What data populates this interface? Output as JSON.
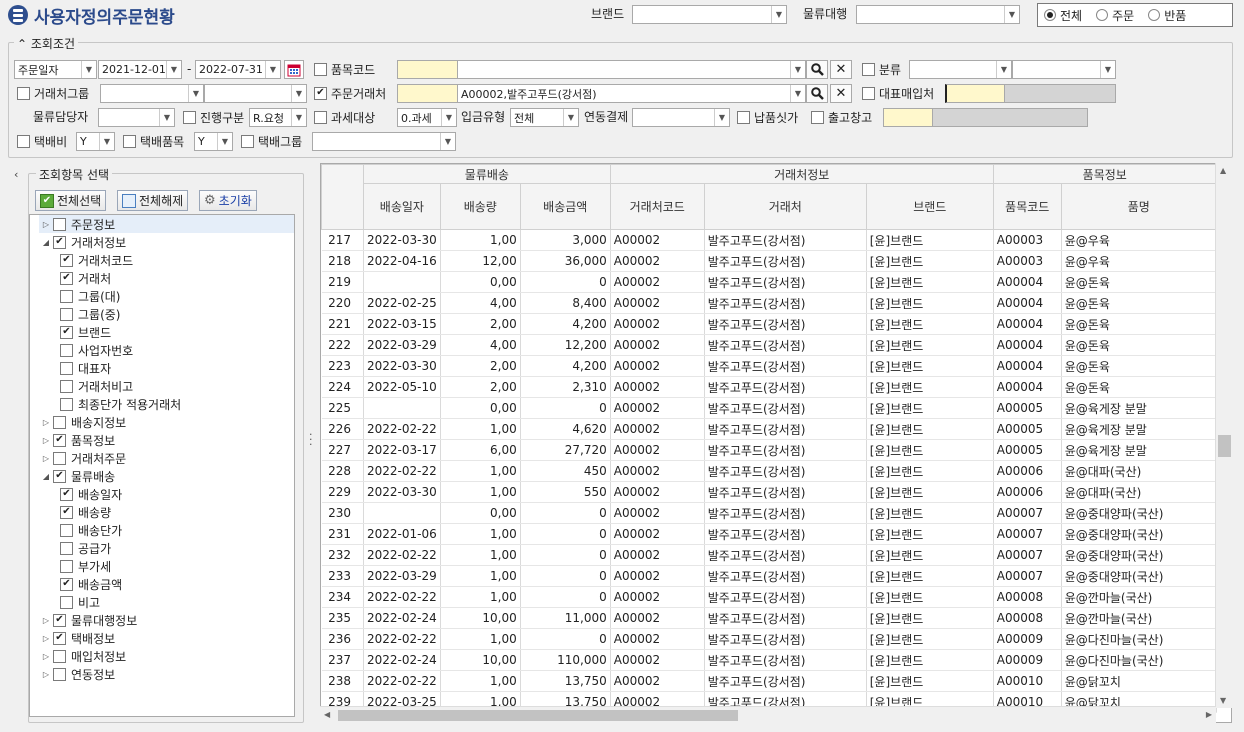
{
  "title": "사용자정의주문현황",
  "brand_label": "브랜드",
  "brand_value": "",
  "logistics_label": "물류대행",
  "logistics_value": "",
  "radios": [
    {
      "label": "전체",
      "selected": true
    },
    {
      "label": "주문",
      "selected": false
    },
    {
      "label": "반품",
      "selected": false
    }
  ],
  "conditions_legend": "조회조건",
  "date_type": "주문일자",
  "date_from": "2021-12-01",
  "date_sep": "-",
  "date_to": "2022-07-31",
  "item_code_label": "품목코드",
  "item_code_value": "",
  "item_code_name": "",
  "class_label": "분류",
  "client_group_label": "거래처그룹",
  "order_client_label": "주문거래처",
  "order_client_code": "",
  "order_client_name": "A00002,발주고푸드(강서점)",
  "rep_buyer_label": "대표매입처",
  "logistics_manager_label": "물류담당자",
  "progress_label": "진행구분",
  "progress_value": "R.요청",
  "tax_label": "과세대상",
  "tax_value": "0.과세",
  "inbound_label": "입금유형",
  "inbound_value": "전체",
  "link_label": "연동결제",
  "delivery_price_label": "납품싯가",
  "warehouse_label": "출고창고",
  "parcel_fee_label": "택배비",
  "parcel_fee_value": "Y",
  "parcel_item_label": "택배품목",
  "parcel_item_value": "Y",
  "parcel_group_label": "택배그룹",
  "select_legend": "조회항목 선택",
  "btn_select_all": "전체선택",
  "btn_deselect_all": "전체해제",
  "btn_reset": "초기화",
  "tree": [
    {
      "label": "주문정보",
      "level": 0,
      "exp": "right",
      "checked": false
    },
    {
      "label": "거래처정보",
      "level": 0,
      "exp": "down",
      "checked": true
    },
    {
      "label": "거래처코드",
      "level": 1,
      "checked": true
    },
    {
      "label": "거래처",
      "level": 1,
      "checked": true
    },
    {
      "label": "그룹(대)",
      "level": 1,
      "checked": false
    },
    {
      "label": "그룹(중)",
      "level": 1,
      "checked": false
    },
    {
      "label": "브랜드",
      "level": 1,
      "checked": true
    },
    {
      "label": "사업자번호",
      "level": 1,
      "checked": false
    },
    {
      "label": "대표자",
      "level": 1,
      "checked": false
    },
    {
      "label": "거래처비고",
      "level": 1,
      "checked": false
    },
    {
      "label": "최종단가 적용거래처",
      "level": 1,
      "checked": false
    },
    {
      "label": "배송지정보",
      "level": 0,
      "exp": "right",
      "checked": false
    },
    {
      "label": "품목정보",
      "level": 0,
      "exp": "right",
      "checked": true
    },
    {
      "label": "거래처주문",
      "level": 0,
      "exp": "right",
      "checked": false
    },
    {
      "label": "물류배송",
      "level": 0,
      "exp": "down",
      "checked": true
    },
    {
      "label": "배송일자",
      "level": 1,
      "checked": true
    },
    {
      "label": "배송량",
      "level": 1,
      "checked": true
    },
    {
      "label": "배송단가",
      "level": 1,
      "checked": false
    },
    {
      "label": "공급가",
      "level": 1,
      "checked": false
    },
    {
      "label": "부가세",
      "level": 1,
      "checked": false
    },
    {
      "label": "배송금액",
      "level": 1,
      "checked": true
    },
    {
      "label": "비고",
      "level": 1,
      "checked": false
    },
    {
      "label": "물류대행정보",
      "level": 0,
      "exp": "right",
      "checked": true
    },
    {
      "label": "택배정보",
      "level": 0,
      "exp": "right",
      "checked": true
    },
    {
      "label": "매입처정보",
      "level": 0,
      "exp": "right",
      "checked": false
    },
    {
      "label": "연동정보",
      "level": 0,
      "exp": "right",
      "checked": false
    }
  ],
  "group_headers": [
    "물류배송",
    "거래처정보",
    "품목정보"
  ],
  "columns": [
    "배송일자",
    "배송량",
    "배송금액",
    "거래처코드",
    "거래처",
    "브랜드",
    "품목코드",
    "품명"
  ],
  "rows": [
    [
      "217",
      "2022-03-30",
      "1,00",
      "3,000",
      "A00002",
      "발주고푸드(강서점)",
      "[윤]브랜드",
      "A00003",
      "윤@우육"
    ],
    [
      "218",
      "2022-04-16",
      "12,00",
      "36,000",
      "A00002",
      "발주고푸드(강서점)",
      "[윤]브랜드",
      "A00003",
      "윤@우육"
    ],
    [
      "219",
      "",
      "0,00",
      "0",
      "A00002",
      "발주고푸드(강서점)",
      "[윤]브랜드",
      "A00004",
      "윤@돈육"
    ],
    [
      "220",
      "2022-02-25",
      "4,00",
      "8,400",
      "A00002",
      "발주고푸드(강서점)",
      "[윤]브랜드",
      "A00004",
      "윤@돈육"
    ],
    [
      "221",
      "2022-03-15",
      "2,00",
      "4,200",
      "A00002",
      "발주고푸드(강서점)",
      "[윤]브랜드",
      "A00004",
      "윤@돈육"
    ],
    [
      "222",
      "2022-03-29",
      "4,00",
      "12,200",
      "A00002",
      "발주고푸드(강서점)",
      "[윤]브랜드",
      "A00004",
      "윤@돈육"
    ],
    [
      "223",
      "2022-03-30",
      "2,00",
      "4,200",
      "A00002",
      "발주고푸드(강서점)",
      "[윤]브랜드",
      "A00004",
      "윤@돈육"
    ],
    [
      "224",
      "2022-05-10",
      "2,00",
      "2,310",
      "A00002",
      "발주고푸드(강서점)",
      "[윤]브랜드",
      "A00004",
      "윤@돈육"
    ],
    [
      "225",
      "",
      "0,00",
      "0",
      "A00002",
      "발주고푸드(강서점)",
      "[윤]브랜드",
      "A00005",
      "윤@육게장 분말"
    ],
    [
      "226",
      "2022-02-22",
      "1,00",
      "4,620",
      "A00002",
      "발주고푸드(강서점)",
      "[윤]브랜드",
      "A00005",
      "윤@육게장 분말"
    ],
    [
      "227",
      "2022-03-17",
      "6,00",
      "27,720",
      "A00002",
      "발주고푸드(강서점)",
      "[윤]브랜드",
      "A00005",
      "윤@육게장 분말"
    ],
    [
      "228",
      "2022-02-22",
      "1,00",
      "450",
      "A00002",
      "발주고푸드(강서점)",
      "[윤]브랜드",
      "A00006",
      "윤@대파(국산)"
    ],
    [
      "229",
      "2022-03-30",
      "1,00",
      "550",
      "A00002",
      "발주고푸드(강서점)",
      "[윤]브랜드",
      "A00006",
      "윤@대파(국산)"
    ],
    [
      "230",
      "",
      "0,00",
      "0",
      "A00002",
      "발주고푸드(강서점)",
      "[윤]브랜드",
      "A00007",
      "윤@중대양파(국산)"
    ],
    [
      "231",
      "2022-01-06",
      "1,00",
      "0",
      "A00002",
      "발주고푸드(강서점)",
      "[윤]브랜드",
      "A00007",
      "윤@중대양파(국산)"
    ],
    [
      "232",
      "2022-02-22",
      "1,00",
      "0",
      "A00002",
      "발주고푸드(강서점)",
      "[윤]브랜드",
      "A00007",
      "윤@중대양파(국산)"
    ],
    [
      "233",
      "2022-03-29",
      "1,00",
      "0",
      "A00002",
      "발주고푸드(강서점)",
      "[윤]브랜드",
      "A00007",
      "윤@중대양파(국산)"
    ],
    [
      "234",
      "2022-02-22",
      "1,00",
      "0",
      "A00002",
      "발주고푸드(강서점)",
      "[윤]브랜드",
      "A00008",
      "윤@깐마늘(국산)"
    ],
    [
      "235",
      "2022-02-24",
      "10,00",
      "11,000",
      "A00002",
      "발주고푸드(강서점)",
      "[윤]브랜드",
      "A00008",
      "윤@깐마늘(국산)"
    ],
    [
      "236",
      "2022-02-22",
      "1,00",
      "0",
      "A00002",
      "발주고푸드(강서점)",
      "[윤]브랜드",
      "A00009",
      "윤@다진마늘(국산)"
    ],
    [
      "237",
      "2022-02-24",
      "10,00",
      "110,000",
      "A00002",
      "발주고푸드(강서점)",
      "[윤]브랜드",
      "A00009",
      "윤@다진마늘(국산)"
    ],
    [
      "238",
      "2022-02-22",
      "1,00",
      "13,750",
      "A00002",
      "발주고푸드(강서점)",
      "[윤]브랜드",
      "A00010",
      "윤@닭꼬치"
    ],
    [
      "239",
      "2022-03-25",
      "1,00",
      "13,750",
      "A00002",
      "발주고푸드(강서점)",
      "[윤]브랜드",
      "A00010",
      "윤@닭꼬치"
    ]
  ]
}
